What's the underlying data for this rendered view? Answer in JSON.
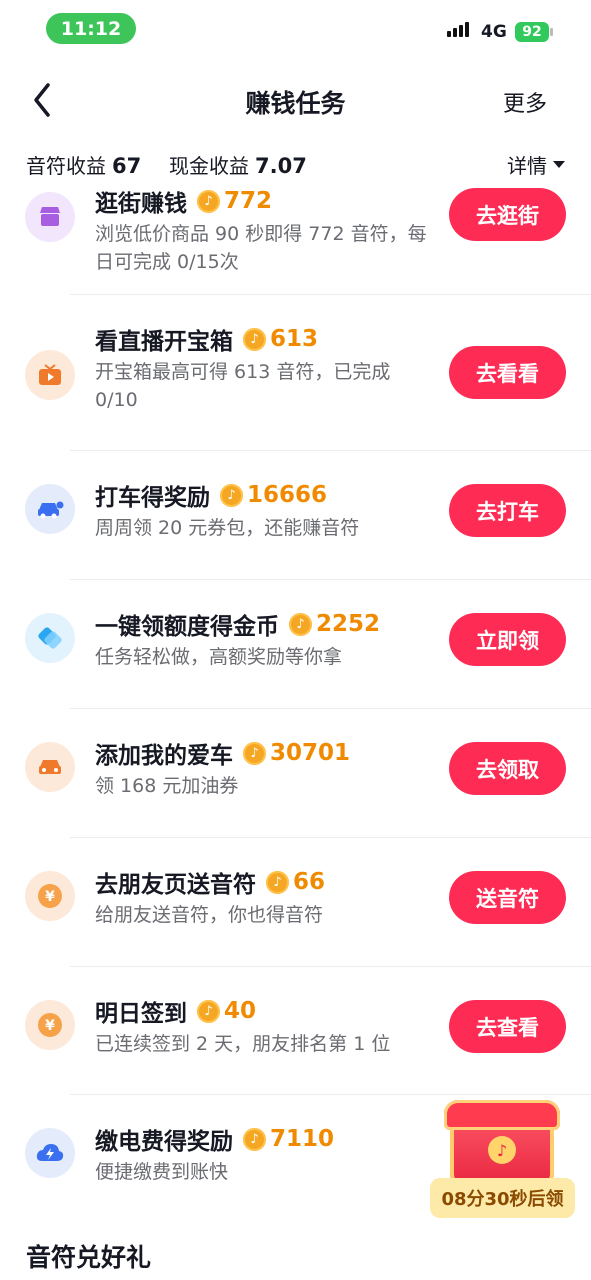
{
  "status_bar": {
    "time": "11:12",
    "network": "4G",
    "battery": "92"
  },
  "nav": {
    "title": "赚钱任务",
    "more": "更多"
  },
  "summary": {
    "notes_label": "音符收益",
    "notes_value": "67",
    "cash_label": "现金收益",
    "cash_value": "7.07",
    "details": "详情"
  },
  "tasks": [
    {
      "title": "逛街赚钱",
      "reward": "772",
      "desc": "浏览低价商品 90 秒即得 772 音符，每日可完成 0/15次",
      "button": "去逛街",
      "icon": "shop-icon",
      "icon_bg": "#f1e6fb",
      "icon_color": "#a75ee0"
    },
    {
      "title": "看直播开宝箱",
      "reward": "613",
      "desc": "开宝箱最高可得 613 音符，已完成 0/10",
      "button": "去看看",
      "icon": "tv-icon",
      "icon_bg": "#fde9d9",
      "icon_color": "#f07a2c"
    },
    {
      "title": "打车得奖励",
      "reward": "16666",
      "desc": "周周领 20 元券包，还能赚音符",
      "button": "去打车",
      "icon": "taxi-icon",
      "icon_bg": "#e4ecfc",
      "icon_color": "#3a6ff0"
    },
    {
      "title": "一键领额度得金币",
      "reward": "2252",
      "desc": "任务轻松做，高额奖励等你拿",
      "button": "立即领",
      "icon": "credit-icon",
      "icon_bg": "#e3f3fd",
      "icon_color": "#2aa7f0"
    },
    {
      "title": "添加我的爱车",
      "reward": "30701",
      "desc": "领 168 元加油券",
      "button": "去领取",
      "icon": "car-icon",
      "icon_bg": "#fde9d9",
      "icon_color": "#f07a2c"
    },
    {
      "title": "去朋友页送音符",
      "reward": "66",
      "desc": "给朋友送音符，你也得音符",
      "button": "送音符",
      "icon": "yen-icon",
      "icon_bg": "#fde9d9",
      "icon_color": "#f5a24a"
    },
    {
      "title": "明日签到",
      "reward": "40",
      "desc": "已连续签到 2 天，朋友排名第 1 位",
      "button": "去查看",
      "icon": "yen-icon",
      "icon_bg": "#fde9d9",
      "icon_color": "#f5a24a"
    },
    {
      "title": "缴电费得奖励",
      "reward": "7110",
      "desc": "便捷缴费到账快",
      "button": "",
      "icon": "bolt-cloud-icon",
      "icon_bg": "#e4ecfc",
      "icon_color": "#3a6ff0"
    }
  ],
  "chest": {
    "timer": "08分30秒后领"
  },
  "section": {
    "title": "音符兑好礼"
  }
}
